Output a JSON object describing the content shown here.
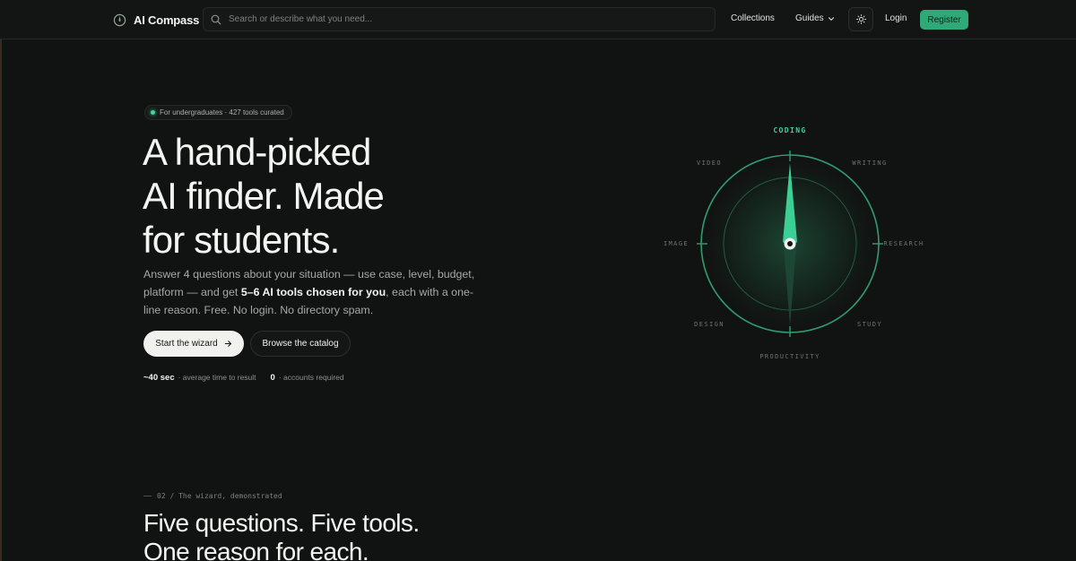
{
  "nav": {
    "logo_text": "AI Compass",
    "search_placeholder": "Search or describe what you need...",
    "links": {
      "collections": "Collections",
      "guides": "Guides",
      "login": "Login"
    },
    "register_label": "Register",
    "accent_color": "#2fa978"
  },
  "hero": {
    "badge": "For undergraduates · 427 tools curated",
    "headline": [
      "A hand-picked",
      "AI finder. Made",
      "for students."
    ],
    "subtitle_before": "Answer 4 questions about your situation — use case, level, budget, platform — and get ",
    "subtitle_bold": "5–6 AI tools chosen for you",
    "subtitle_after": ", each with a one-line reason. Free. No login. No directory spam.",
    "primary_button": "Start the wizard",
    "secondary_button": "Browse the catalog",
    "stats": [
      {
        "value": "~40 sec",
        "label": "· average time to result"
      },
      {
        "value": "0",
        "label": "· accounts required"
      }
    ]
  },
  "compass": {
    "active": "CODING",
    "labels": {
      "top": "CODING",
      "top_left": "VIDEO",
      "top_right": "WRITING",
      "left": "IMAGE",
      "right": "RESEARCH",
      "bottom_left": "DESIGN",
      "bottom_right": "STUDY",
      "bottom": "PRODUCTIVITY"
    }
  },
  "section2": {
    "label": "02 / The wizard, demonstrated",
    "title": [
      "Five questions. Five tools.",
      "One reason for each."
    ]
  }
}
